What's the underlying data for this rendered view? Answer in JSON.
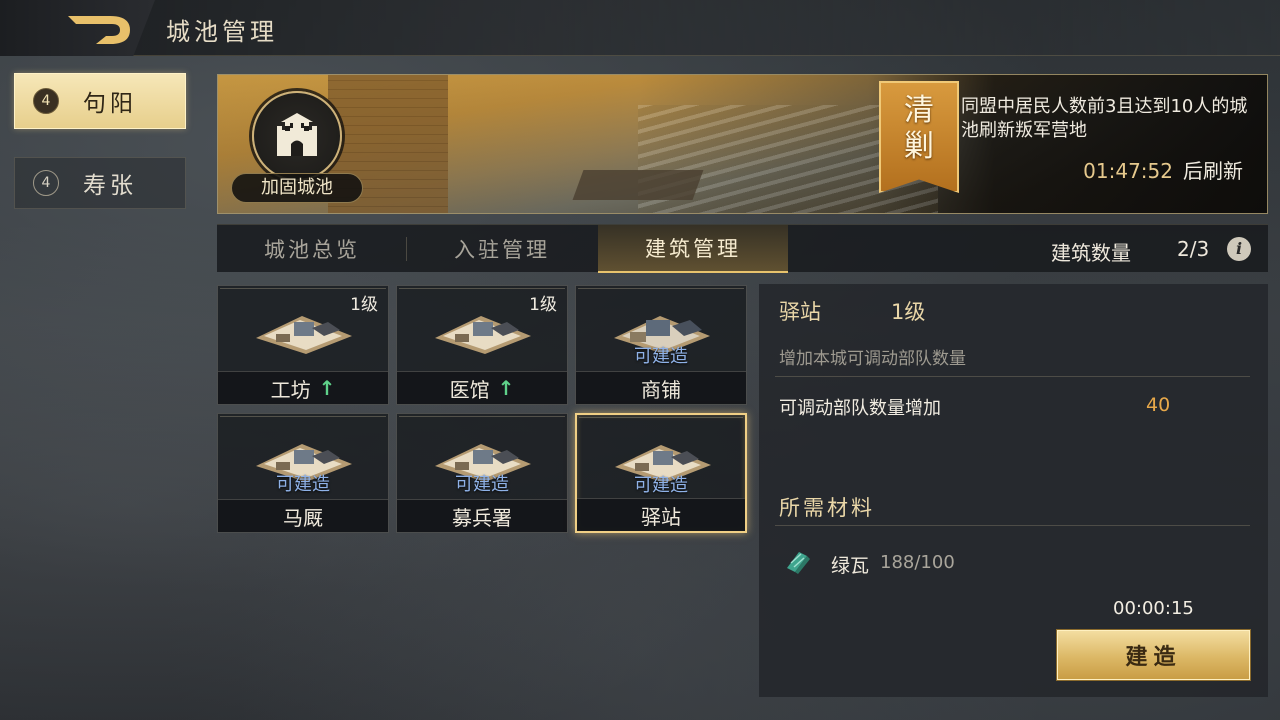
{
  "header": {
    "title": "城池管理",
    "back_icon": "back-arrow-icon"
  },
  "cities": [
    {
      "level": "4",
      "name": "句阳",
      "active": true
    },
    {
      "level": "4",
      "name": "寿张",
      "active": false
    }
  ],
  "banner": {
    "fortify_label": "加固城池",
    "badge_chars": [
      "清",
      "剿"
    ],
    "description": "同盟中居民人数前3且达到10人的城池刷新叛军营地",
    "countdown": "01:47:52",
    "countdown_suffix": "后刷新"
  },
  "tabs": [
    {
      "label": "城池总览",
      "active": false
    },
    {
      "label": "入驻管理",
      "active": false
    },
    {
      "label": "建筑管理",
      "active": true
    }
  ],
  "building_count": {
    "label": "建筑数量",
    "value": "2/3"
  },
  "buildings": [
    {
      "name": "工坊",
      "level": "1级",
      "buildable": "",
      "upgradable": true
    },
    {
      "name": "医馆",
      "level": "1级",
      "buildable": "",
      "upgradable": true
    },
    {
      "name": "商铺",
      "level": "",
      "buildable": "可建造",
      "upgradable": false
    },
    {
      "name": "马厩",
      "level": "",
      "buildable": "可建造",
      "upgradable": false
    },
    {
      "name": "募兵署",
      "level": "",
      "buildable": "可建造",
      "upgradable": false
    },
    {
      "name": "驿站",
      "level": "",
      "buildable": "可建造",
      "upgradable": false,
      "selected": true
    }
  ],
  "upgrade_arrow": "↑",
  "detail": {
    "name": "驿站",
    "level": "1级",
    "description": "增加本城可调动部队数量",
    "stat_label": "可调动部队数量增加",
    "stat_value": "40",
    "materials_title": "所需材料",
    "material_name": "绿瓦",
    "material_qty": "188/100",
    "build_time": "00:00:15",
    "build_button": "建造"
  },
  "colors": {
    "accent_gold": "#e8c36d",
    "buildable_blue": "#8fb2e8",
    "upgrade_green": "#5fd28a",
    "stat_orange": "#e7a84a"
  }
}
